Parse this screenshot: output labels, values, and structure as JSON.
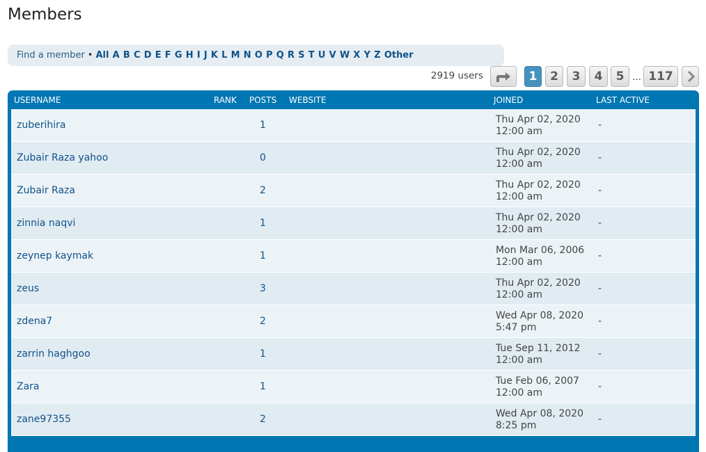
{
  "page": {
    "title": "Members"
  },
  "alpha_bar": {
    "label": "Find a member",
    "bullet": "•",
    "letters": [
      "All",
      "A",
      "B",
      "C",
      "D",
      "E",
      "F",
      "G",
      "H",
      "I",
      "J",
      "K",
      "L",
      "M",
      "N",
      "O",
      "P",
      "Q",
      "R",
      "S",
      "T",
      "U",
      "V",
      "W",
      "X",
      "Y",
      "Z",
      "Other"
    ]
  },
  "pagination": {
    "user_count": "2919 users",
    "jump_icon": "share-arrow-icon",
    "pages": [
      "1",
      "2",
      "3",
      "4",
      "5"
    ],
    "ellipsis": "…",
    "last_page": "117",
    "next_icon": "chevron-right-icon",
    "current_page": "1"
  },
  "table": {
    "headers": {
      "username": "USERNAME",
      "rank": "RANK",
      "posts": "POSTS",
      "website": "WEBSITE",
      "joined": "JOINED",
      "last_active": "LAST ACTIVE"
    },
    "rows": [
      {
        "username": "zuberihira",
        "posts": "1",
        "joined_date": "Thu Apr 02, 2020",
        "joined_time": "12:00 am",
        "last_active": "-"
      },
      {
        "username": "Zubair Raza yahoo",
        "posts": "0",
        "joined_date": "Thu Apr 02, 2020",
        "joined_time": "12:00 am",
        "last_active": "-"
      },
      {
        "username": "Zubair Raza",
        "posts": "2",
        "joined_date": "Thu Apr 02, 2020",
        "joined_time": "12:00 am",
        "last_active": "-"
      },
      {
        "username": "zinnia naqvi",
        "posts": "1",
        "joined_date": "Thu Apr 02, 2020",
        "joined_time": "12:00 am",
        "last_active": "-"
      },
      {
        "username": "zeynep kaymak",
        "posts": "1",
        "joined_date": "Mon Mar 06, 2006",
        "joined_time": "12:00 am",
        "last_active": "-"
      },
      {
        "username": "zeus",
        "posts": "3",
        "joined_date": "Thu Apr 02, 2020",
        "joined_time": "12:00 am",
        "last_active": "-"
      },
      {
        "username": "zdena7",
        "posts": "2",
        "joined_date": "Wed Apr 08, 2020",
        "joined_time": "5:47 pm",
        "last_active": "-"
      },
      {
        "username": "zarrin haghgoo",
        "posts": "1",
        "joined_date": "Tue Sep 11, 2012",
        "joined_time": "12:00 am",
        "last_active": "-"
      },
      {
        "username": "Zara",
        "posts": "1",
        "joined_date": "Tue Feb 06, 2007",
        "joined_time": "12:00 am",
        "last_active": "-"
      },
      {
        "username": "zane97355",
        "posts": "2",
        "joined_date": "Wed Apr 08, 2020",
        "joined_time": "8:25 pm",
        "last_active": "-"
      }
    ]
  },
  "colors": {
    "header_bg": "#0076b3",
    "row_odd": "#ecf3f7",
    "row_even": "#e1ebf2",
    "link": "#105289",
    "active_page": "#4692bf"
  }
}
